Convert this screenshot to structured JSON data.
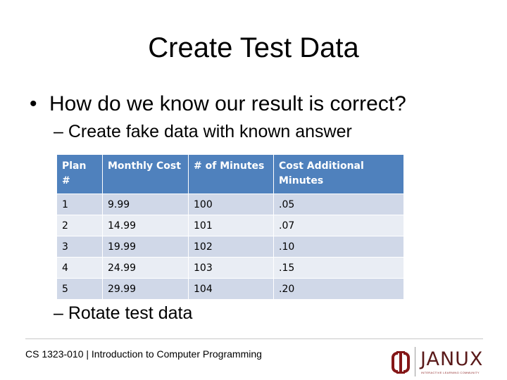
{
  "slide": {
    "title": "Create Test Data",
    "bullet": "How do we know our result is correct?",
    "bullet_marker": "•",
    "sub_items": [
      "– Create fake data with known answer",
      "– Rotate test data"
    ]
  },
  "table": {
    "headers": [
      "Plan #",
      "Monthly Cost",
      "# of Minutes",
      "Cost Additional Minutes"
    ],
    "rows": [
      [
        "1",
        "9.99",
        "100",
        ".05"
      ],
      [
        "2",
        "14.99",
        "101",
        ".07"
      ],
      [
        "3",
        "19.99",
        "102",
        ".10"
      ],
      [
        "4",
        "24.99",
        "103",
        ".15"
      ],
      [
        "5",
        "29.99",
        "104",
        ".20"
      ]
    ]
  },
  "footer": {
    "course": "CS 1323-010 | Introduction to Computer Programming",
    "logo_text": "JANUX",
    "logo_tagline": "INTERACTIVE LEARNING COMMUNITY",
    "colors": {
      "brand": "#841617",
      "table_header": "#4f81bd",
      "row_odd": "#d0d8e8",
      "row_even": "#e9edf4"
    }
  }
}
